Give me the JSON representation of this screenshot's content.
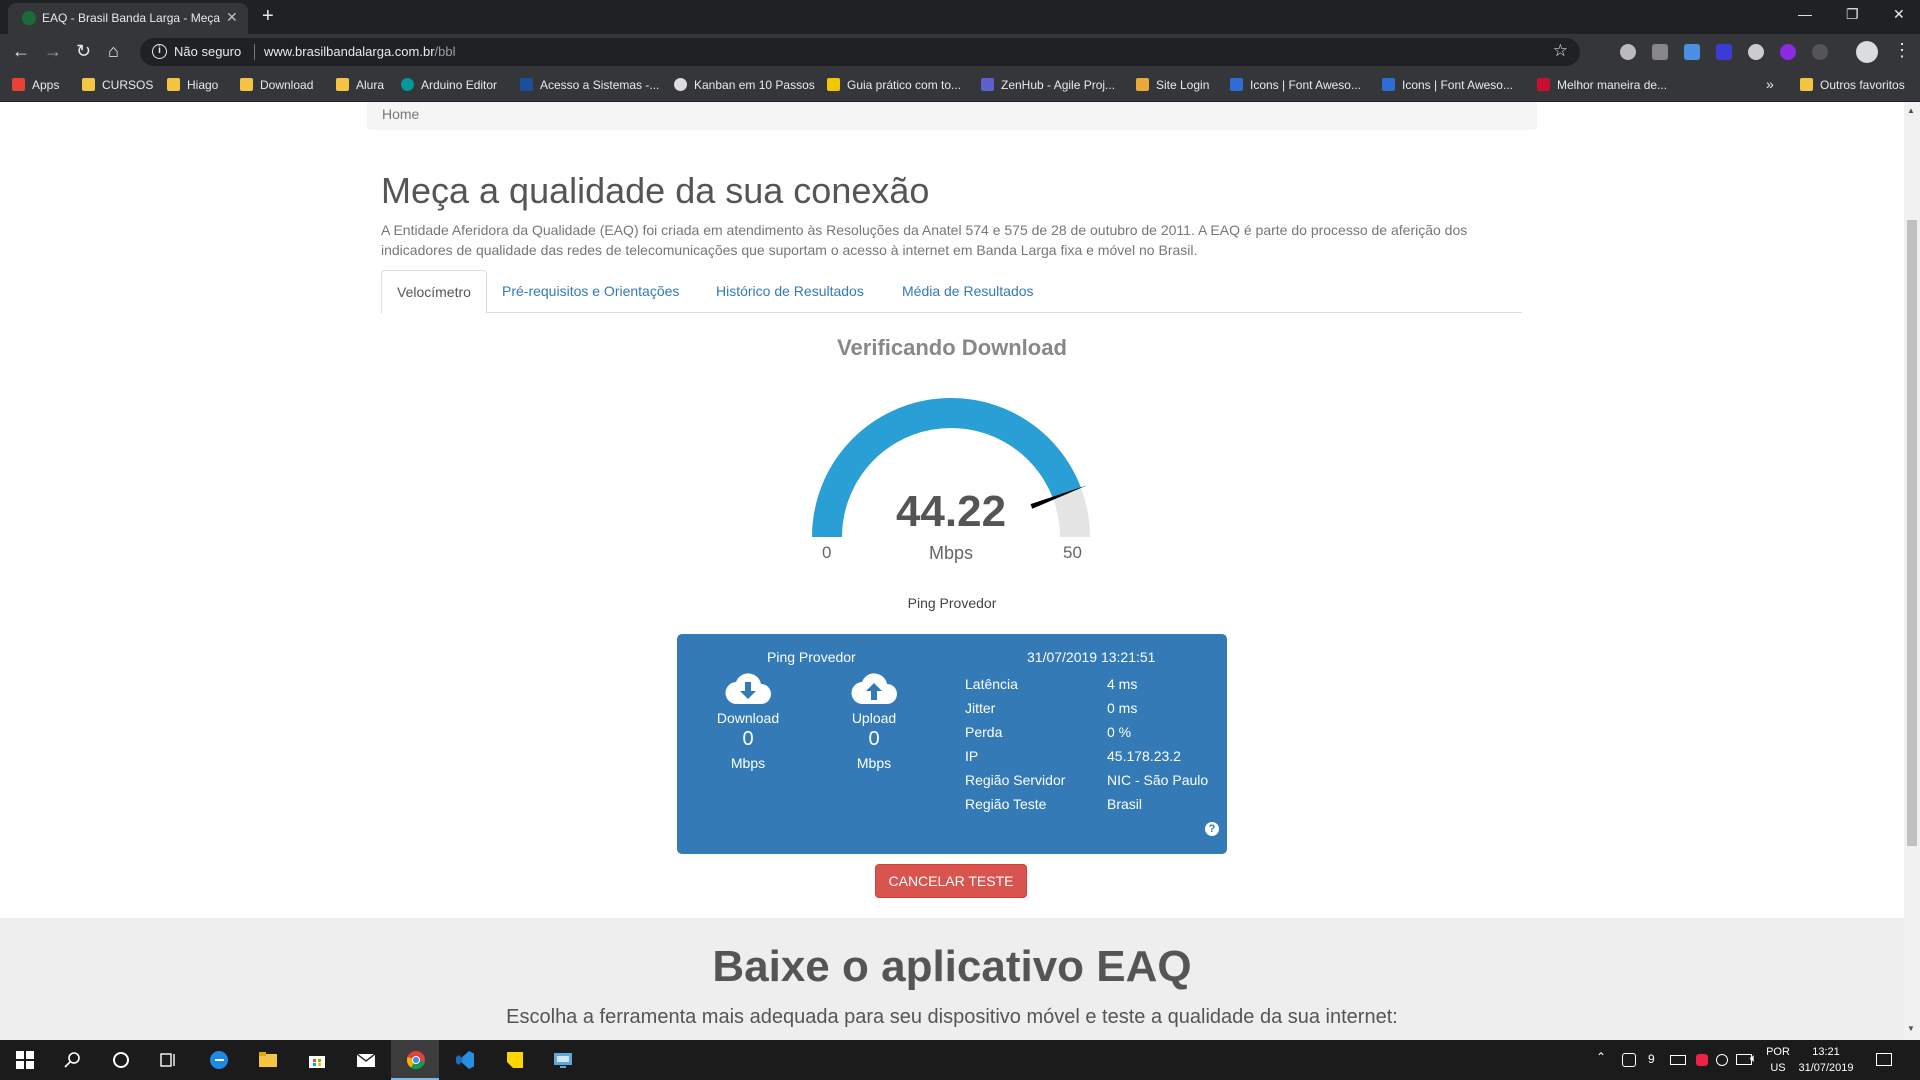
{
  "browser": {
    "tab_title": "EAQ - Brasil Banda Larga - Meça",
    "security_label": "Não seguro",
    "url_host": "www.brasilbandalarga.com.br",
    "url_path": "/bbl",
    "bookmarks": [
      "Apps",
      "CURSOS",
      "Hiago",
      "Download",
      "Alura",
      "Arduino Editor",
      "Acesso a Sistemas -...",
      "Kanban em 10 Passos",
      "Guia prático com to...",
      "ZenHub - Agile Proj...",
      "Site Login",
      "Icons | Font Aweso...",
      "Icons | Font Aweso...",
      "Melhor maneira de..."
    ],
    "other_bookmarks": "Outros favoritos",
    "overflow": "»"
  },
  "page": {
    "breadcrumb": "Home",
    "title": "Meça a qualidade da sua conexão",
    "intro": "A Entidade Aferidora da Qualidade (EAQ) foi criada em atendimento às Resoluções da Anatel 574 e 575 de 28 de outubro de 2011. A EAQ é parte do processo de aferição dos indicadores de qualidade das redes de telecomunicações que suportam o acesso à internet em Banda Larga fixa e móvel no Brasil.",
    "tabs": [
      "Velocímetro",
      "Pré-requisitos e Orientações",
      "Histórico de Resultados",
      "Média de Resultados"
    ],
    "active_tab": 0,
    "status_title": "Verificando Download",
    "gauge": {
      "value": "44.22",
      "unit": "Mbps",
      "min": "0",
      "max": "50",
      "value_num": 44.22,
      "min_num": 0,
      "max_num": 50,
      "fill_color": "#2a9fd6",
      "track_color": "#e5e5e5",
      "needle_color": "#000000"
    },
    "ping_label": "Ping Provedor",
    "result": {
      "header": "Ping Provedor",
      "timestamp": "31/07/2019 13:21:51",
      "download": {
        "label": "Download",
        "value": "0",
        "unit": "Mbps"
      },
      "upload": {
        "label": "Upload",
        "value": "0",
        "unit": "Mbps"
      },
      "metrics": [
        {
          "key": "Latência",
          "value": "4 ms"
        },
        {
          "key": "Jitter",
          "value": "0 ms"
        },
        {
          "key": "Perda",
          "value": "0 %"
        },
        {
          "key": "IP",
          "value": "45.178.23.2"
        },
        {
          "key": "Região Servidor",
          "value": "NIC - São Paulo"
        },
        {
          "key": "Região Teste",
          "value": "Brasil"
        }
      ],
      "help": "?"
    },
    "cancel_button": "CANCELAR TESTE",
    "app_title": "Baixe o aplicativo EAQ",
    "app_subtitle": "Escolha a ferramenta mais adequada para seu dispositivo móvel e teste a qualidade da sua internet:"
  },
  "taskbar": {
    "lang_top": "POR",
    "lang_bottom": "US",
    "time": "13:21",
    "date": "31/07/2019",
    "tray_badge": "9"
  },
  "colors": {
    "panel": "#337ab7",
    "danger": "#d9534f",
    "link": "#337ab7"
  }
}
